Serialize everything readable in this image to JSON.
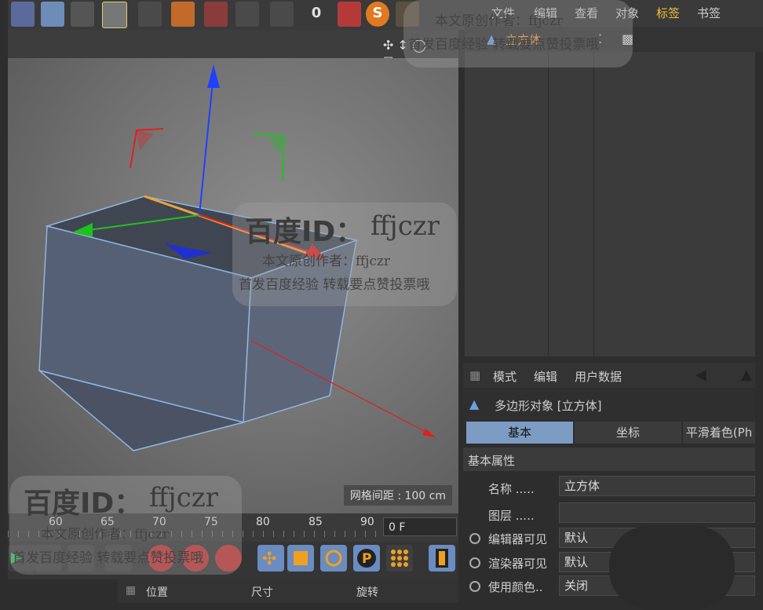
{
  "menu": [
    "文件",
    "编辑",
    "查看",
    "对象",
    "标签",
    "书签"
  ],
  "object_row": {
    "name": "立方体"
  },
  "timeline": {
    "ticks": [
      "60",
      "65",
      "70",
      "75",
      "80",
      "85",
      "90"
    ],
    "frame_value": "0 F"
  },
  "viewport": {
    "grid_spacing": "网格间距 : 100 cm"
  },
  "toolbar": {
    "counter_value": "0"
  },
  "coords_header": [
    "位置",
    "尺寸",
    "旋转"
  ],
  "attributes": {
    "menu": [
      "模式",
      "编辑",
      "用户数据"
    ],
    "title": "多边形对象 [立方体]",
    "tabs": [
      "基本",
      "坐标",
      "平滑着色(Ph"
    ],
    "section": "基本属性",
    "props": [
      {
        "label": "名称 .....",
        "value": "立方体"
      },
      {
        "label": "图层 .....",
        "value": ""
      },
      {
        "label": "编辑器可见",
        "value": "默认"
      },
      {
        "label": "渲染器可见",
        "value": "默认"
      },
      {
        "label": "使用颜色..",
        "value": "关闭"
      }
    ]
  },
  "watermarks": [
    {
      "id_label": "百度ID：",
      "id": "ffjczr",
      "line1": "本文原创作者：ffjczr",
      "line2": "首发百度经验 转载要点赞投票哦"
    }
  ],
  "colors": {
    "accent": "#f2a23a",
    "tab_active": "#7d9cc4",
    "axis_x": "#e02020",
    "axis_y": "#20c020",
    "axis_z": "#2040ff"
  }
}
